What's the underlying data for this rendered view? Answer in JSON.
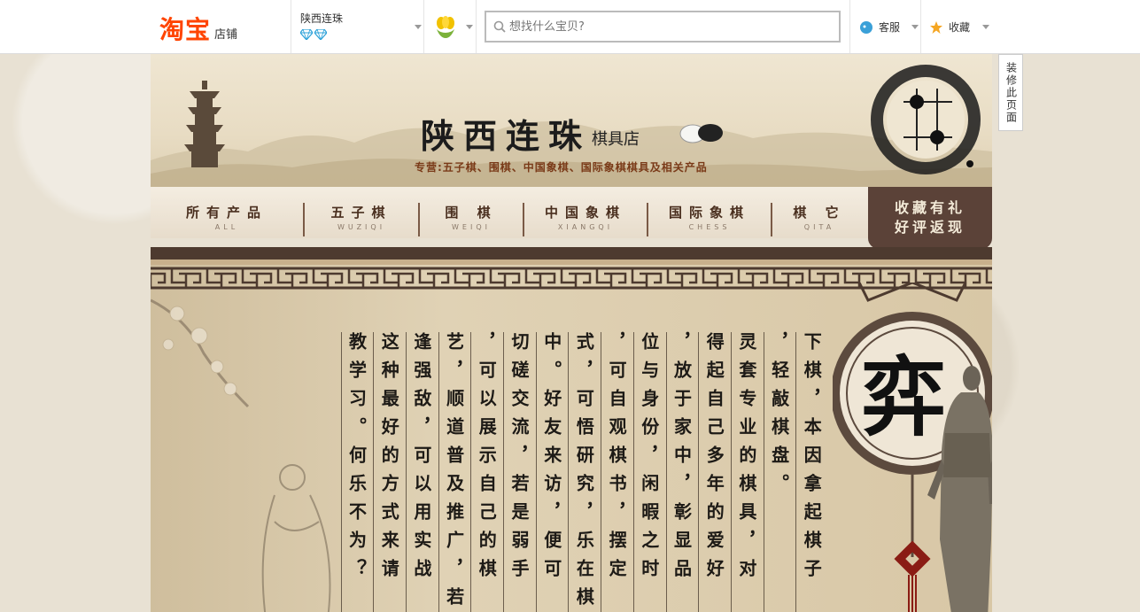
{
  "topbar": {
    "logo_main": "淘宝",
    "logo_sub": "店铺",
    "shop_name": "陕西连珠",
    "search_placeholder": "想找什么宝贝?",
    "service_label": "客服",
    "favorite_label": "收藏"
  },
  "banner": {
    "title": "陕西连珠",
    "title_sub": "棋具店",
    "tagline": "专营:五子棋、围棋、中国象棋、国际象棋棋具及相关产品"
  },
  "decorate_label": "装修此页面",
  "nav": {
    "items": [
      {
        "cn": "所有产品",
        "en": "ALL"
      },
      {
        "cn": "五子棋",
        "en": "WUZIQI"
      },
      {
        "cn": "围 棋",
        "en": "WEIQI"
      },
      {
        "cn": "中国象棋",
        "en": "XIANGQI"
      },
      {
        "cn": "国际象棋",
        "en": "CHESS"
      },
      {
        "cn": "棋 它",
        "en": "QITA"
      }
    ],
    "promo_line1": "收藏有礼",
    "promo_line2": "好评返现"
  },
  "content": {
    "medallion_char": "弈",
    "columns": [
      "下棋，本因拿起棋子",
      "，轻敲棋盘。",
      "灵套专业的棋具，对",
      "得起自己多年的爱好",
      "，放于家中，彰显品",
      "位与身份，闲暇之时",
      "，可自观棋书，摆定",
      "式，可悟研究，乐在棋",
      "中。好友来访，便可",
      "切磋交流，若是弱手",
      "，可以展示自己的棋",
      "艺，顺道普及推广，若",
      "逢强敌，可以用实战",
      "这种最好的方式来请",
      "教学习。何乐不为？"
    ]
  },
  "colors": {
    "taobao_orange": "#ff4400",
    "nav_brown": "#4a2f1f",
    "promo_bg": "#5b4238"
  }
}
